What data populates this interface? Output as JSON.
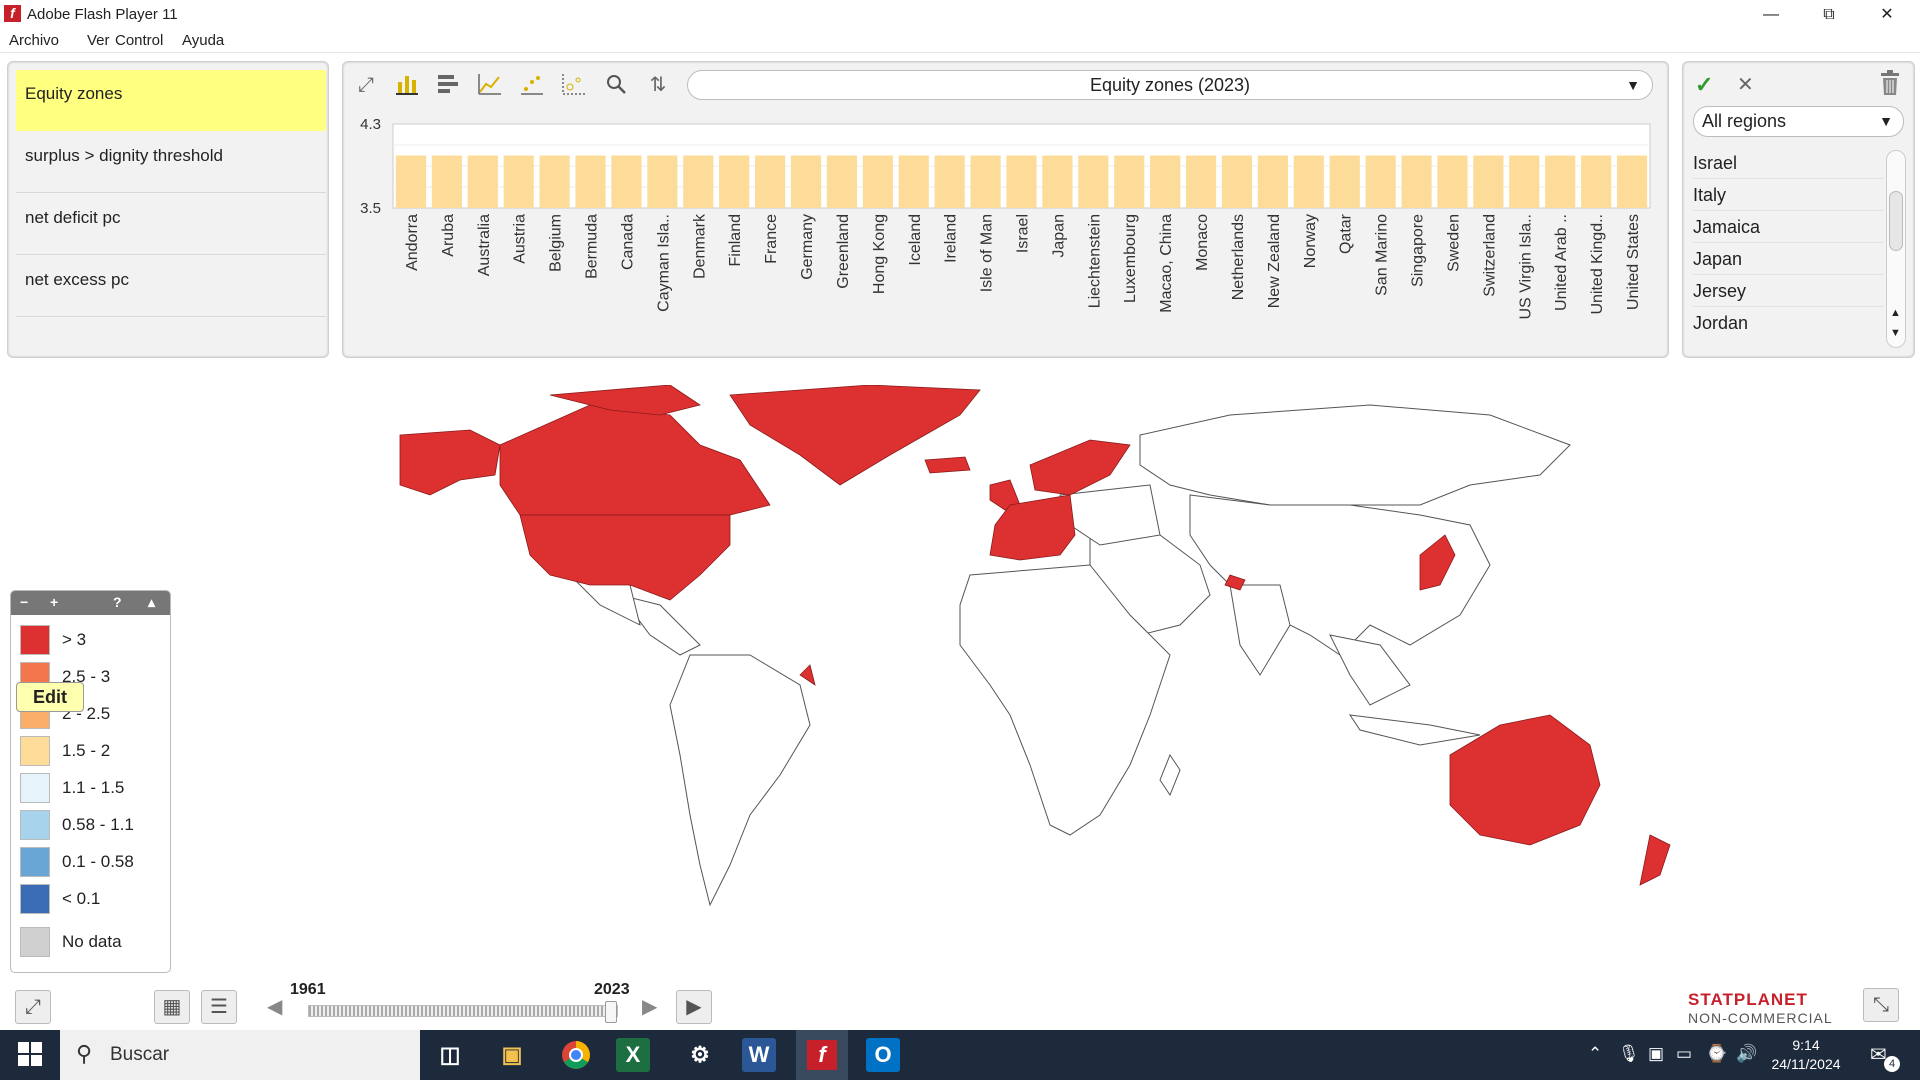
{
  "window": {
    "title": "Adobe Flash Player 11",
    "logo_glyph": "f"
  },
  "menu": [
    "Archivo",
    "Ver",
    "Control",
    "Ayuda"
  ],
  "indicators": {
    "items": [
      {
        "label": "Equity zones",
        "active": true
      },
      {
        "label": "surplus > dignity threshold",
        "active": false
      },
      {
        "label": "net deficit pc",
        "active": false
      },
      {
        "label": "net excess pc",
        "active": false
      }
    ]
  },
  "chart_toolbar": {
    "icons": [
      "expand-icon",
      "bar-chart-icon",
      "horizontal-bar-icon",
      "line-chart-icon",
      "scatter-icon",
      "bubble-chart-icon",
      "search-icon",
      "sort-icon"
    ]
  },
  "chart_select": {
    "value": "Equity zones (2023)"
  },
  "chart_data": {
    "type": "bar",
    "title": "",
    "ylim": [
      3.5,
      4.3
    ],
    "yticks": [
      "4.3",
      "3.5"
    ],
    "categories": [
      "Andorra",
      "Aruba",
      "Australia",
      "Austria",
      "Belgium",
      "Bermuda",
      "Canada",
      "Cayman Isla..",
      "Denmark",
      "Finland",
      "France",
      "Germany",
      "Greenland",
      "Hong Kong",
      "Iceland",
      "Ireland",
      "Isle of Man",
      "Israel",
      "Japan",
      "Liechtenstein",
      "Luxembourg",
      "Macao, China",
      "Monaco",
      "Netherlands",
      "New Zealand",
      "Norway",
      "Qatar",
      "San Marino",
      "Singapore",
      "Sweden",
      "Switzerland",
      "US Virgin Isla..",
      "United Arab ..",
      "United Kingd..",
      "United States"
    ],
    "values": [
      4,
      4,
      4,
      4,
      4,
      4,
      4,
      4,
      4,
      4,
      4,
      4,
      4,
      4,
      4,
      4,
      4,
      4,
      4,
      4,
      4,
      4,
      4,
      4,
      4,
      4,
      4,
      4,
      4,
      4,
      4,
      4,
      4,
      4,
      4
    ],
    "bar_color": "#fddc9a",
    "grid": true
  },
  "regions": {
    "select_value": "All regions",
    "items": [
      "Israel",
      "Italy",
      "Jamaica",
      "Japan",
      "Jersey",
      "Jordan"
    ]
  },
  "legend": {
    "header": [
      "−",
      "+",
      "?",
      "▴"
    ],
    "rows": [
      {
        "label": "> 3",
        "color": "#dd3131"
      },
      {
        "label": "2.5 - 3",
        "color": "#f4764d"
      },
      {
        "label": "2 - 2.5",
        "color": "#fbae67"
      },
      {
        "label": "1.5 - 2",
        "color": "#fddc9a"
      },
      {
        "label": "1.1 - 1.5",
        "color": "#e5f4fa"
      },
      {
        "label": "0.58 - 1.1",
        "color": "#a7d4ec"
      },
      {
        "label": "0.1 - 0.58",
        "color": "#6aa6d5"
      },
      {
        "label": "< 0.1",
        "color": "#3a6db5"
      },
      {
        "label": "No data",
        "color": "#d0d0d0"
      }
    ],
    "tooltip": "Edit"
  },
  "timeline": {
    "start": "1961",
    "end": "2023",
    "position": 1.0
  },
  "brand": {
    "line1": "STATPLANET",
    "line2": "NON-COMMERCIAL"
  },
  "taskbar": {
    "search_placeholder": "Buscar",
    "time": "9:14",
    "date": "24/11/2024",
    "notifications": "4"
  },
  "colors": {
    "highlight": "#dd3131",
    "active_indicator": "#ffff80"
  }
}
